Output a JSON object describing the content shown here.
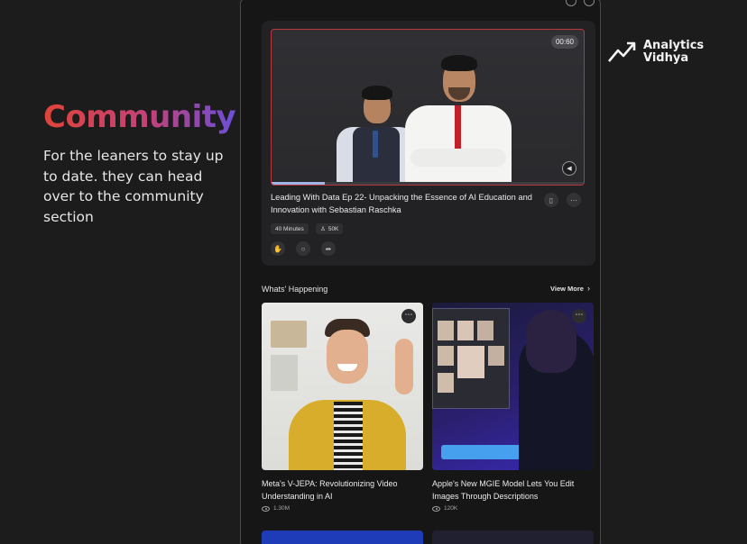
{
  "promo": {
    "title": "Community",
    "description": "For the leaners to stay up to date. they can head over to the community section"
  },
  "logo": {
    "line1": "Analytics",
    "line2": "Vidhya",
    "icon": "trend-arrow-icon"
  },
  "featured": {
    "duration": "00:60",
    "progress": 0.17,
    "title": "Leading With Data Ep 22- Unpacking the Essence of AI Education and Innovation with Sebastian Raschka",
    "chips": {
      "length": "40 Minutes",
      "views": "50K"
    },
    "actions": [
      "like-icon",
      "comment-icon",
      "share-icon"
    ]
  },
  "section": {
    "title": "Whats' Happening",
    "view_more": "View More"
  },
  "articles": [
    {
      "title": "Meta's V-JEPA: Revolutionizing Video Understanding in AI",
      "views": "1.30M"
    },
    {
      "title": "Apple's New MGIE Model Lets You Edit Images Through Descriptions",
      "views": "120K"
    }
  ],
  "colors": {
    "accent_gradient": [
      "#e0443a",
      "#c2417a",
      "#6a4fd6"
    ],
    "video_border": "#b7373c",
    "progress": "#9fb6e6",
    "background": "#1c1c1d"
  }
}
